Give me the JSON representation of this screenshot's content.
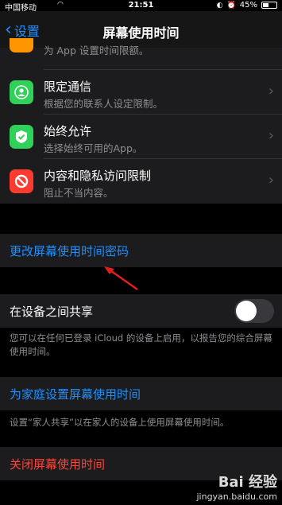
{
  "status_bar": {
    "carrier": "中国移动",
    "time": "21:51",
    "battery": "45%",
    "battery_level": 0.45
  },
  "nav": {
    "back_label": "设置",
    "title": "屏幕使用时间"
  },
  "top_partial": {
    "subtitle": "为 App 设置时间限额。"
  },
  "rows": [
    {
      "title": "限定通信",
      "subtitle": "根据您的联系人设定限制。",
      "icon": "person-icon",
      "color": "#30D158"
    },
    {
      "title": "始终允许",
      "subtitle": "选择始终可用的App。",
      "icon": "checkmark-icon",
      "color": "#30D158"
    },
    {
      "title": "内容和隐私访问限制",
      "subtitle": "阻止不当内容。",
      "icon": "prohibit-icon",
      "color": "#FF3B30"
    }
  ],
  "change_passcode": "更改屏幕使用时间密码",
  "share": {
    "label": "在设备之间共享",
    "enabled": false,
    "note": "您可以在任何已登录 iCloud 的设备上启用，以报告您的综合屏幕使用时间。"
  },
  "family": {
    "label": "为家庭设置屏幕使用时间",
    "note": "设置“家人共享”以在家人的设备上使用屏幕使用时间。"
  },
  "turn_off": "关闭屏幕使用时间",
  "watermark": {
    "brand": "Bai 经验",
    "url": "jingyan.baidu.com"
  }
}
